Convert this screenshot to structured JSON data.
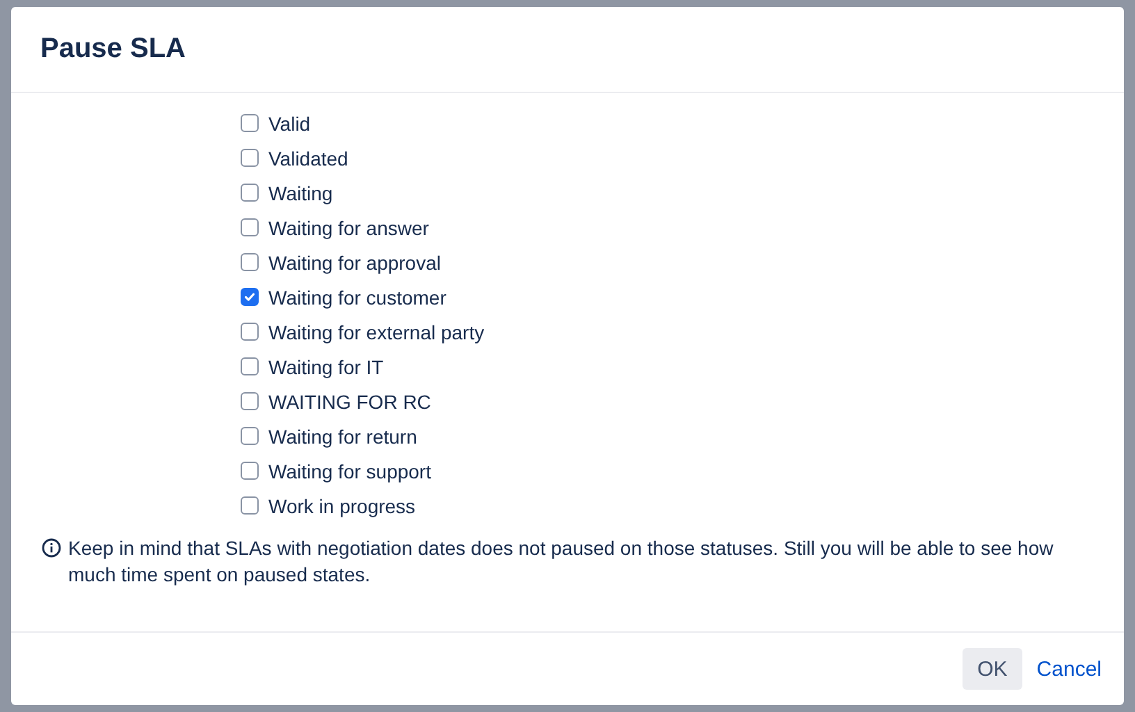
{
  "dialog": {
    "title": "Pause SLA",
    "statuses": [
      {
        "label": "Valid",
        "checked": false
      },
      {
        "label": "Validated",
        "checked": false
      },
      {
        "label": "Waiting",
        "checked": false
      },
      {
        "label": "Waiting for answer",
        "checked": false
      },
      {
        "label": "Waiting for approval",
        "checked": false
      },
      {
        "label": "Waiting for customer",
        "checked": true
      },
      {
        "label": "Waiting for external party",
        "checked": false
      },
      {
        "label": "Waiting for IT",
        "checked": false
      },
      {
        "label": "WAITING FOR RC",
        "checked": false
      },
      {
        "label": "Waiting for return",
        "checked": false
      },
      {
        "label": "Waiting for support",
        "checked": false
      },
      {
        "label": "Work in progress",
        "checked": false
      }
    ],
    "note": "Keep in mind that SLAs with negotiation dates does not paused on those statuses. Still you will be able to see how much time spent on paused states.",
    "buttons": [
      {
        "label": "OK",
        "kind": "primary"
      },
      {
        "label": "Cancel",
        "kind": "link"
      }
    ]
  }
}
